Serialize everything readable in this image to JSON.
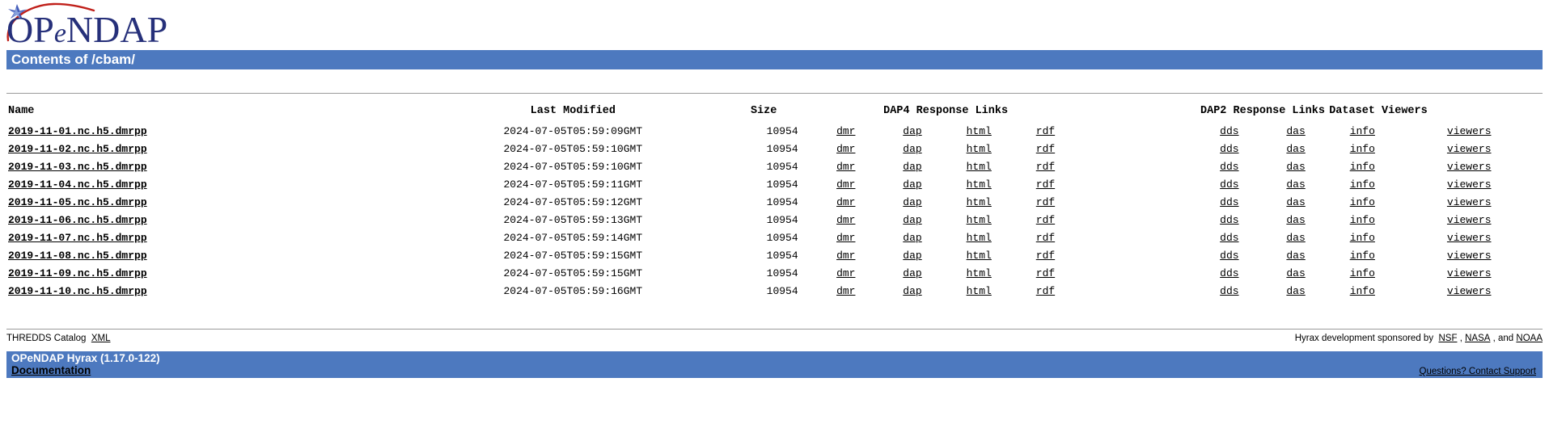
{
  "logo": {
    "alt": "opendap-logo",
    "text": "OPeNDAP",
    "swoosh_color": "#c0201a",
    "text_color": "#26307a",
    "star_color": "#3a53b5"
  },
  "header": {
    "title": "Contents of /cbam/",
    "banner_color": "#4d79bf"
  },
  "table": {
    "columns": [
      "Name",
      "Last Modified",
      "Size",
      "DAP4 Response Links",
      "DAP2 Response Links",
      "Dataset Viewers"
    ],
    "link_labels": {
      "dmr": "dmr",
      "dap": "dap",
      "html": "html",
      "rdf": "rdf",
      "dds": "dds",
      "das": "das",
      "info": "info",
      "viewers": "viewers"
    },
    "rows": [
      {
        "name": "2019-11-01.nc.h5.dmrpp",
        "modified": "2024-07-05T05:59:09GMT",
        "size": "10954"
      },
      {
        "name": "2019-11-02.nc.h5.dmrpp",
        "modified": "2024-07-05T05:59:10GMT",
        "size": "10954"
      },
      {
        "name": "2019-11-03.nc.h5.dmrpp",
        "modified": "2024-07-05T05:59:10GMT",
        "size": "10954"
      },
      {
        "name": "2019-11-04.nc.h5.dmrpp",
        "modified": "2024-07-05T05:59:11GMT",
        "size": "10954"
      },
      {
        "name": "2019-11-05.nc.h5.dmrpp",
        "modified": "2024-07-05T05:59:12GMT",
        "size": "10954"
      },
      {
        "name": "2019-11-06.nc.h5.dmrpp",
        "modified": "2024-07-05T05:59:13GMT",
        "size": "10954"
      },
      {
        "name": "2019-11-07.nc.h5.dmrpp",
        "modified": "2024-07-05T05:59:14GMT",
        "size": "10954"
      },
      {
        "name": "2019-11-08.nc.h5.dmrpp",
        "modified": "2024-07-05T05:59:15GMT",
        "size": "10954"
      },
      {
        "name": "2019-11-09.nc.h5.dmrpp",
        "modified": "2024-07-05T05:59:15GMT",
        "size": "10954"
      },
      {
        "name": "2019-11-10.nc.h5.dmrpp",
        "modified": "2024-07-05T05:59:16GMT",
        "size": "10954"
      }
    ]
  },
  "footer": {
    "thredds_text": "THREDDS Catalog",
    "thredds_link": "XML",
    "sponsor_prefix": "Hyrax development sponsored by",
    "sponsor_nsf": "NSF",
    "sponsor_sep1": ",",
    "sponsor_nasa": "NASA",
    "sponsor_sep2": ", and",
    "sponsor_noaa": "NOAA"
  },
  "hyrax": {
    "version_line": "OPeNDAP Hyrax (1.17.0-122)",
    "documentation": "Documentation",
    "support": "Questions? Contact Support",
    "banner_color": "#4d79bf"
  }
}
